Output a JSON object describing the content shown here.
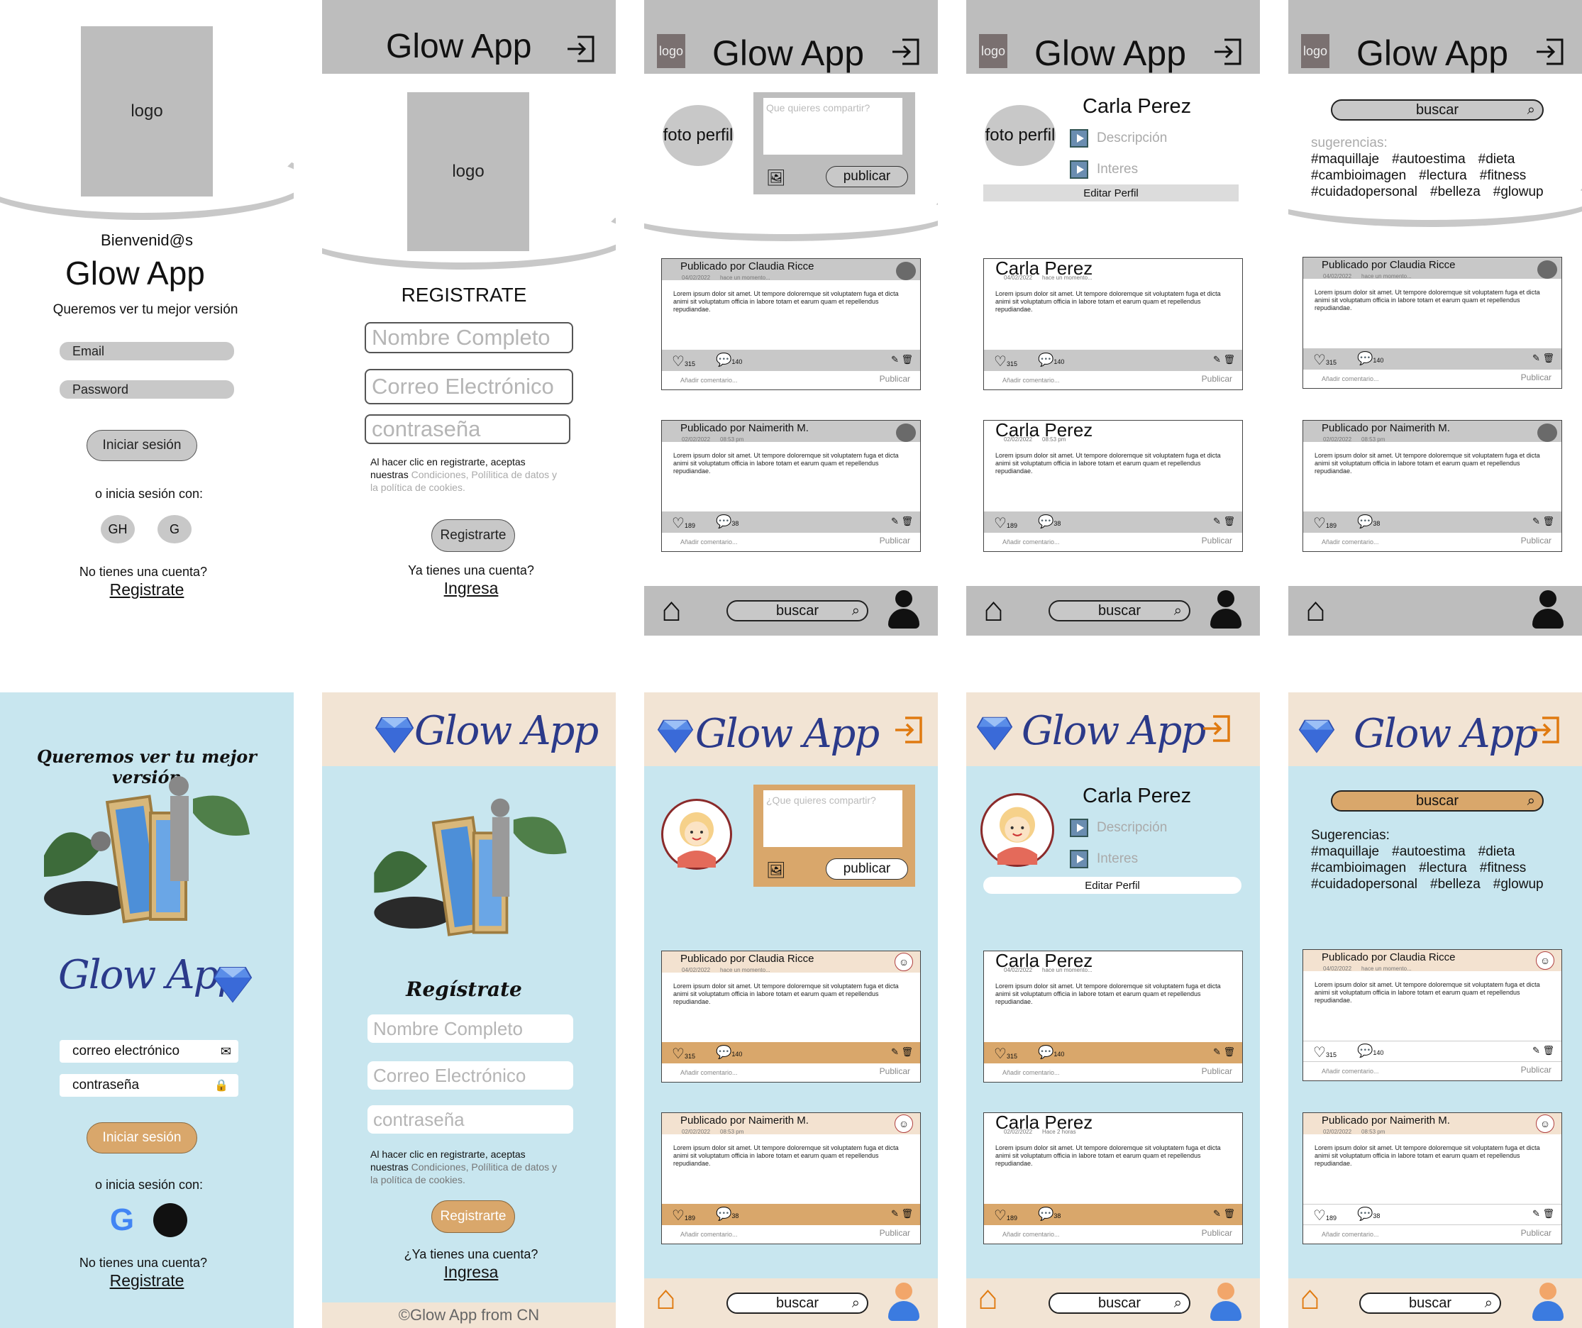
{
  "login": {
    "logo": "logo",
    "welcome": "Bienvenid@s",
    "app_name": "Glow App",
    "tagline": "Queremos ver tu mejor versión",
    "email_ph": "Email",
    "password_ph": "Password",
    "login_btn": "Iniciar sesión",
    "or_login": "o inicia sesión con:",
    "social": [
      "GH",
      "G"
    ],
    "no_account": "No tienes una cuenta?",
    "register_link": "Registrate"
  },
  "register": {
    "app_name": "Glow App",
    "logo": "logo",
    "title": "REGISTRATE",
    "name_ph": "Nombre Completo",
    "email_ph": "Correo Electrónico",
    "pass_ph": "contraseña",
    "terms_a": "Al hacer clic en registrarte, aceptas",
    "terms_b": "nuestras",
    "terms_links": "Condiciones, Polílitica de datos y",
    "terms_links2": "la política de cookies.",
    "btn": "Registrarte",
    "have_account": "Ya tienes una cuenta?",
    "login_link": "Ingresa"
  },
  "feed": {
    "logo": "logo",
    "app_name": "Glow App",
    "photo_label": "foto perfil",
    "share_ph": "Que quieres compartir?",
    "publish": "publicar",
    "search": "buscar"
  },
  "posts": [
    {
      "author": "Publicado por Claudia Ricce",
      "date": "04/02/2022",
      "ago": "hace un momento...",
      "body": "Lorem ipsum dolor sit amet. Ut tempore doloremque sit voluptatem fuga et dicta animi sit voluptatum officia in labore totam et earum quam et repellendus repudiandae.",
      "likes": "315",
      "comments": "140",
      "add": "Añadir comentario...",
      "publish": "Publicar"
    },
    {
      "author": "Publicado por Naimerith M.",
      "date": "02/02/2022",
      "ago": "08:53 pm",
      "body": "Lorem ipsum dolor sit amet. Ut tempore doloremque sit voluptatem fuga et dicta animi sit voluptatum officia in labore totam et earum quam et repellendus repudiandae.",
      "likes": "189",
      "comments": "38",
      "add": "Añadir comentario...",
      "publish": "Publicar"
    }
  ],
  "profile": {
    "name": "Carla Perez",
    "photo_label": "foto perfil",
    "desc": "Descripción",
    "interests": "Interes",
    "edit": "Editar Perfil",
    "post1_ago": "hace un momento...",
    "post2_ago": "08:53 pm",
    "post2_ago_hf": "Hace 2 horas"
  },
  "search_screen": {
    "search": "buscar",
    "sugg_label_wf": "sugerencias:",
    "sugg_label_hf": "Sugerencias:",
    "tags_row1": [
      "#maquillaje",
      "#autoestima",
      "#dieta"
    ],
    "tags_row2": [
      "#cambioimagen",
      "#lectura",
      "#fitness"
    ],
    "tags_row3": [
      "#cuidadopersonal",
      "#belleza",
      "#glowup"
    ]
  },
  "hifi": {
    "tagline": "Queremos ver tu mejor versión",
    "app_script": "Glow App",
    "email_ph": "correo electrónico",
    "pass_ph": "contraseña",
    "login_btn": "Iniciar sesión",
    "or_login": "o inicia sesión con:",
    "no_account": "No tienes una cuenta?",
    "register_link": "Registrate",
    "register_title": "Regístrate",
    "have_account": "¿Ya tienes una cuenta?",
    "login_link": "Ingresa",
    "footer": "©Glow App from CN",
    "share_ph": "¿Que quieres compartir?"
  },
  "colors": {
    "wire_gray": "#bdbdbd",
    "hifi_bg": "#c8e6ef",
    "hifi_header": "#f2e4d4",
    "accent_tan": "#d9a76b",
    "brand_blue": "#2b3a8a"
  }
}
